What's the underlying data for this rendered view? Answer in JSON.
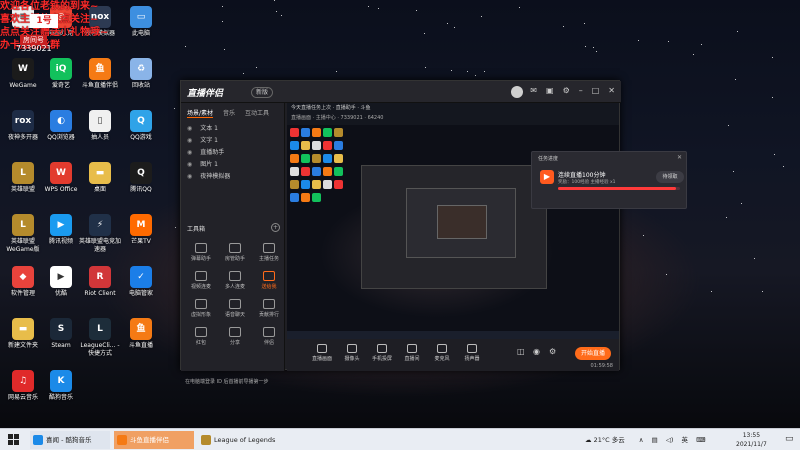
{
  "overlay": {
    "lines": [
      "欢迎各位老铁的到来~",
      "喜欢主播的点点关注~",
      "点点关注赠送小礼物哦~",
      "办卡加粉丝群"
    ],
    "badge": "1号",
    "room_label": "房间号",
    "room_number": "7339021"
  },
  "desktop": {
    "icons": [
      {
        "label": "",
        "icon": "doc-icon",
        "color": "#f2f2f2",
        "glyph": "≡"
      },
      {
        "label": "电脑八克",
        "icon": "robot-icon",
        "color": "#e43",
        "glyph": "◎"
      },
      {
        "label": "夜神模拟器",
        "icon": "nox-icon",
        "color": "#2d3a52",
        "glyph": "nox"
      },
      {
        "label": "此电脑",
        "icon": "computer-icon",
        "color": "#3d8fe0",
        "glyph": "▭"
      },
      {
        "label": "WeGame",
        "icon": "wegame-icon",
        "color": "#1b1b1b",
        "glyph": "W"
      },
      {
        "label": "爱奇艺",
        "icon": "iqiyi-icon",
        "color": "#12c15c",
        "glyph": "iQ"
      },
      {
        "label": "斗鱼直播伴侣",
        "icon": "douyu-icon",
        "color": "#f57a14",
        "glyph": "鱼"
      },
      {
        "label": "回收站",
        "icon": "recycle-bin-icon",
        "color": "#8ab4e8",
        "glyph": "♻"
      },
      {
        "label": "夜神多开器",
        "icon": "nox-multi-icon",
        "color": "#1e2c46",
        "glyph": "rox"
      },
      {
        "label": "QQ浏览器",
        "icon": "qq-browser-icon",
        "color": "#2a7de1",
        "glyph": "◐"
      },
      {
        "label": "抽人员",
        "icon": "file-icon",
        "color": "#f0f0f0",
        "glyph": "▯"
      },
      {
        "label": "QQ游戏",
        "icon": "qq-game-icon",
        "color": "#2fa3e8",
        "glyph": "Q"
      },
      {
        "label": "英雄联盟",
        "icon": "lol-icon",
        "color": "#b58b2c",
        "glyph": "L"
      },
      {
        "label": "WPS Office",
        "icon": "wps-icon",
        "color": "#e23b2e",
        "glyph": "W"
      },
      {
        "label": "桌面",
        "icon": "folder-icon",
        "color": "#e8bd4a",
        "glyph": "▬"
      },
      {
        "label": "腾讯QQ",
        "icon": "qq-icon",
        "color": "#1c1c1c",
        "glyph": "Q"
      },
      {
        "label": "英雄联盟WeGame版",
        "icon": "lol-wegame-icon",
        "color": "#b58b2c",
        "glyph": "L"
      },
      {
        "label": "腾讯视频",
        "icon": "tencent-video-icon",
        "color": "#1a9bf0",
        "glyph": "▶"
      },
      {
        "label": "英雄联盟电竞加速器",
        "icon": "accelerator-icon",
        "color": "#203048",
        "glyph": "⚡"
      },
      {
        "label": "芒果TV",
        "icon": "mango-tv-icon",
        "color": "#ff6a00",
        "glyph": "M"
      },
      {
        "label": "软件管理",
        "icon": "software-manager-icon",
        "color": "#e8433c",
        "glyph": "◆"
      },
      {
        "label": "优酷",
        "icon": "youku-icon",
        "color": "#ffffff",
        "glyph": "▶"
      },
      {
        "label": "Riot Client",
        "icon": "riot-icon",
        "color": "#d13639",
        "glyph": "R"
      },
      {
        "label": "电脑管家",
        "icon": "pc-manager-icon",
        "color": "#1b7ee8",
        "glyph": "✓"
      },
      {
        "label": "新建文件夹",
        "icon": "new-folder-icon",
        "color": "#e8bd4a",
        "glyph": "▬"
      },
      {
        "label": "Steam",
        "icon": "steam-icon",
        "color": "#1b2838",
        "glyph": "S"
      },
      {
        "label": "LeagueCli... - 快捷方式",
        "icon": "league-client-icon",
        "color": "#1d2d3a",
        "glyph": "L"
      },
      {
        "label": "斗鱼直播",
        "icon": "douyu-live-icon",
        "color": "#f57a14",
        "glyph": "鱼"
      },
      {
        "label": "网易云音乐",
        "icon": "netease-music-icon",
        "color": "#e02a2a",
        "glyph": "♫"
      },
      {
        "label": "酷狗音乐",
        "icon": "kugou-icon",
        "color": "#1b8ae8",
        "glyph": "K"
      }
    ]
  },
  "app": {
    "title": "直播伴侣",
    "version": "新版",
    "left_tabs": [
      "场景/素材",
      "音乐",
      "互动工具"
    ],
    "sources": [
      {
        "label": "文本 1",
        "state": "visible"
      },
      {
        "label": "文字 1",
        "state": "visible"
      },
      {
        "label": "直播助手",
        "state": "visible"
      },
      {
        "label": "图片 1",
        "state": "visible"
      },
      {
        "label": "夜神模拟器",
        "state": "visible"
      }
    ],
    "tools_title": "工具箱",
    "tools": [
      "弹幕助手",
      "房管助手",
      "主播任务",
      "视频连麦",
      "多人连麦",
      "送给我",
      "虚拟形象",
      "语音聊天",
      "贡献排行",
      "红包",
      "分享",
      "伴侣"
    ],
    "bottom_tip": "在电脑端登录 ID 后首播前导播第一步",
    "preview_header": "今天直播任务上次 · 直播助手 · 斗鱼",
    "preview_sub": "直播画面 · 主播中心 · 7339021 · 64240",
    "popup": {
      "title": "任务进度",
      "task": "连续直播100分钟",
      "subtitle": "奖励：100经验 主播经验 x1",
      "button": "待领取",
      "progress": 0.97
    },
    "controls": [
      "直播画面",
      "摄像头",
      "手机投屏",
      "直播间",
      "麦克风",
      "扬声器"
    ],
    "live_button": "开始直播",
    "timer": "01:59:58"
  },
  "taskbar": {
    "items": [
      {
        "label": "",
        "icon": "windows-start-icon"
      },
      {
        "label": "喜闻 - 酷狗音乐",
        "icon": "kugou-taskbar-icon",
        "color": "#1b8ae8"
      },
      {
        "label": "斗鱼直播伴侣",
        "icon": "douyu-taskbar-icon",
        "color": "#f57a14"
      },
      {
        "label": "League of Legends",
        "icon": "lol-taskbar-icon",
        "color": "#b58b2c"
      }
    ],
    "weather": "21°C 多云",
    "ime": "英",
    "time": "13:55",
    "date": "2021/11/7"
  }
}
